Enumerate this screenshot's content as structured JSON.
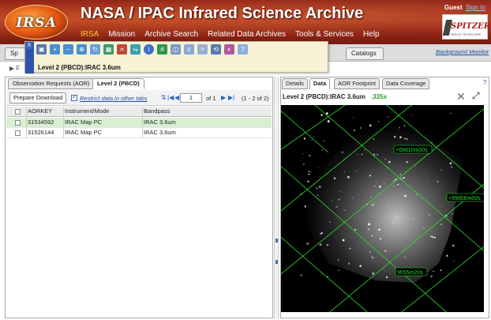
{
  "header": {
    "logo_text": "IRSA",
    "title": "NASA / IPAC Infrared Science Archive",
    "nav": [
      "IRSA",
      "Mission",
      "Archive Search",
      "Related Data Archives",
      "Tools & Services",
      "Help"
    ],
    "guest": "Guest",
    "sign_in": "Sign In",
    "spitzer": "SPITZER",
    "spitzer_sub": "SPACE TELESCOPE"
  },
  "subbar": {
    "left_tab": "Sp",
    "catalogs_tab": "Catalogs",
    "background_monitor": "Background Monitor"
  },
  "toolbar": {
    "close": "X",
    "label": "Level 2 (PBCD):IRAC 3.6um",
    "icons": [
      "save-icon",
      "zoom-in-icon",
      "zoom-out-icon",
      "zoom-fit-icon",
      "rotate-icon",
      "layers-icon",
      "crop-icon",
      "flip-icon",
      "info-icon",
      "grid-icon",
      "area-icon",
      "stats-icon",
      "compass-icon",
      "restore-icon",
      "color-icon",
      "help-icon"
    ]
  },
  "row_marker": "▶ F",
  "left": {
    "tabs": [
      "Observation Requests (AOR)",
      "Level 2 (PBCD)"
    ],
    "prepare_download": "Prepare Download",
    "restrict_label": "Restrict data in other tabs",
    "page_value": "1",
    "page_of": "of  1",
    "page_range": "(1 - 2 of 2)",
    "columns": [
      "AORKEY",
      "Instrument/Mode",
      "Bandpass"
    ],
    "rows": [
      {
        "aorkey": "31534592",
        "mode": "IRAC Map PC",
        "band": "IRAC 3.6um"
      },
      {
        "aorkey": "31526144",
        "mode": "IRAC Map PC",
        "band": "IRAC 3.6um"
      }
    ]
  },
  "right": {
    "tabs": [
      "Details",
      "Data",
      "AOR Footprint",
      "Data Coverage"
    ],
    "help": "?",
    "image_title": "Level 2 (PBCD):IRAC 3.6um",
    "zoom": ".335x",
    "grid_labels": [
      "+69d10m00s",
      "+69d06m00s",
      "9h55m20s"
    ]
  }
}
